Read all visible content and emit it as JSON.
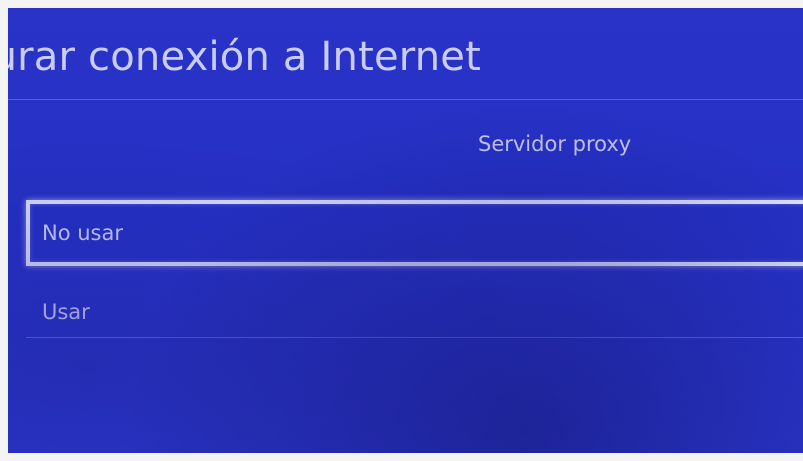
{
  "header": {
    "title": "gurar conexión a Internet"
  },
  "section": {
    "subtitle": "Servidor proxy"
  },
  "options": [
    {
      "label": "No usar",
      "selected": true
    },
    {
      "label": "Usar",
      "selected": false
    }
  ],
  "colors": {
    "background": "#2a33c8",
    "text": "#c9cdf3",
    "selection_border": "#dde0fa"
  }
}
